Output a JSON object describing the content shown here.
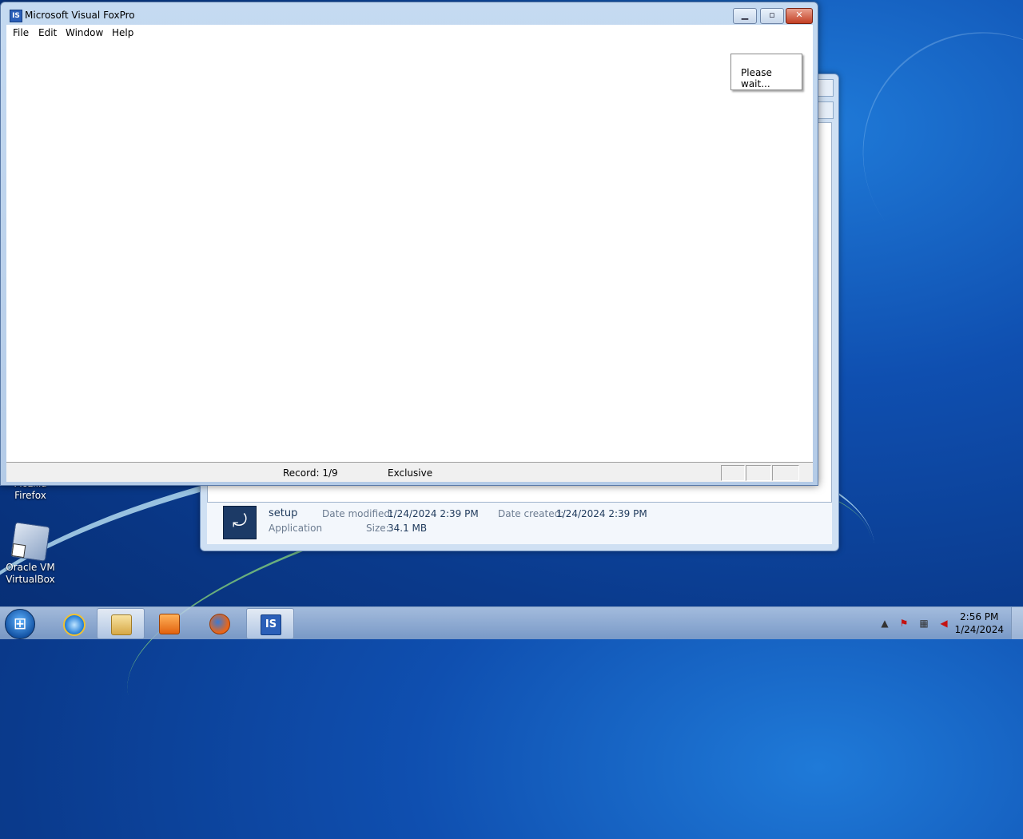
{
  "desktop": {
    "icons": [
      {
        "label_line1": "Mozilla",
        "label_line2": "Firefox"
      },
      {
        "label_line1": "Oracle VM",
        "label_line2": "VirtualBox"
      }
    ]
  },
  "explorer": {
    "details": {
      "file_name": "setup",
      "file_type": "Application",
      "date_modified_label": "Date modified:",
      "date_modified_value": "1/24/2024 2:39 PM",
      "date_created_label": "Date created:",
      "date_created_value": "1/24/2024 2:39 PM",
      "size_label": "Size:",
      "size_value": "34.1 MB"
    }
  },
  "foxpro": {
    "app_icon_text": "IS",
    "title": "Microsoft Visual FoxPro",
    "buttons": {
      "minimize": "▁",
      "maximize": "▫",
      "close": "✕"
    },
    "menu": [
      "File",
      "Edit",
      "Window",
      "Help"
    ],
    "wait_message": "Please wait...",
    "status": {
      "record": "Record: 1/9",
      "mode": "Exclusive"
    }
  },
  "taskbar": {
    "apps": [
      "internet-explorer",
      "windows-explorer",
      "media-player",
      "firefox",
      "foxpro-setup"
    ],
    "tray": {
      "time": "2:56 PM",
      "date": "1/24/2024"
    }
  },
  "colors": {
    "desktop": "#0f4fb0",
    "taskbar": "#a6bfdf",
    "close_button": "#c33f24"
  }
}
